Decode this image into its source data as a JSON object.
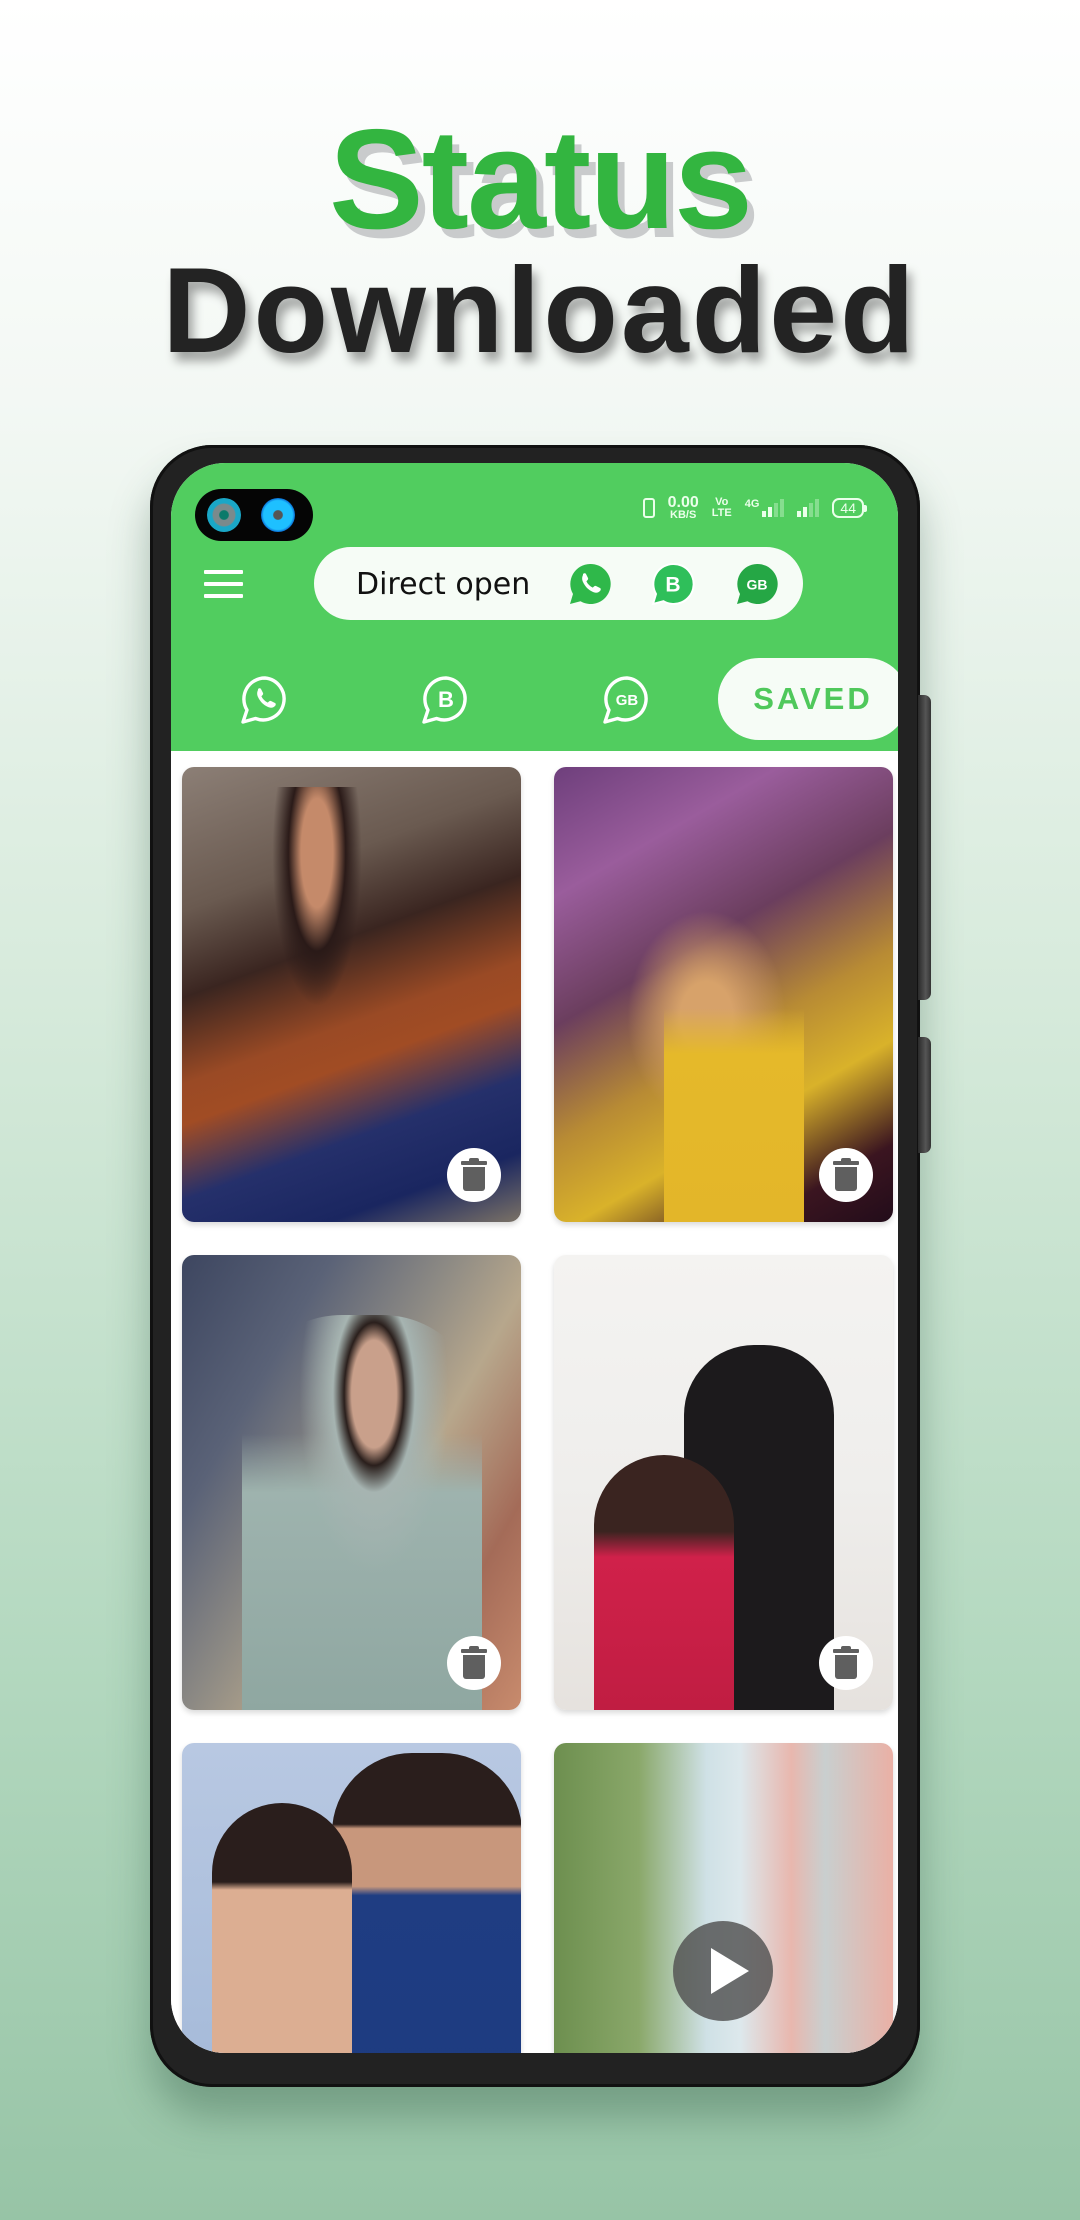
{
  "promo": {
    "headline_line1": "Status",
    "headline_line2": "Downloaded",
    "accent_color": "#33b540"
  },
  "status_bar": {
    "speed_value": "0.00",
    "speed_unit": "KB/S",
    "volte_top": "Vo",
    "volte_bottom": "LTE",
    "network": "4G",
    "battery": "44"
  },
  "app_bar": {
    "menu_icon": "hamburger-menu-icon",
    "direct_open_label": "Direct open",
    "direct_open_apps": [
      {
        "name": "whatsapp",
        "icon": "whatsapp-icon"
      },
      {
        "name": "whatsapp-business",
        "icon": "whatsapp-business-icon",
        "letter": "B"
      },
      {
        "name": "gb-whatsapp",
        "icon": "gb-whatsapp-icon",
        "letter": "GB"
      }
    ],
    "header_color": "#51cd5f"
  },
  "tabs": [
    {
      "name": "whatsapp",
      "icon": "whatsapp-outline-icon",
      "active": false
    },
    {
      "name": "whatsapp-business",
      "icon": "whatsapp-business-outline-icon",
      "letter": "B",
      "active": false
    },
    {
      "name": "gb-whatsapp",
      "icon": "gb-whatsapp-outline-icon",
      "letter": "GB",
      "active": false
    },
    {
      "name": "saved",
      "label": "SAVED",
      "active": true
    }
  ],
  "saved_items": [
    {
      "type": "image",
      "subject": "woman in sunglasses and rust top",
      "action": "delete"
    },
    {
      "type": "image",
      "subject": "woman in yellow dress with purple bokeh",
      "action": "delete"
    },
    {
      "type": "image",
      "subject": "man in grey hoodie with tattoo",
      "action": "delete"
    },
    {
      "type": "image",
      "subject": "couple embracing",
      "action": "delete"
    },
    {
      "type": "image",
      "subject": "wedding couple"
    },
    {
      "type": "video",
      "subject": "trees and pink pillar",
      "action": "play"
    }
  ]
}
